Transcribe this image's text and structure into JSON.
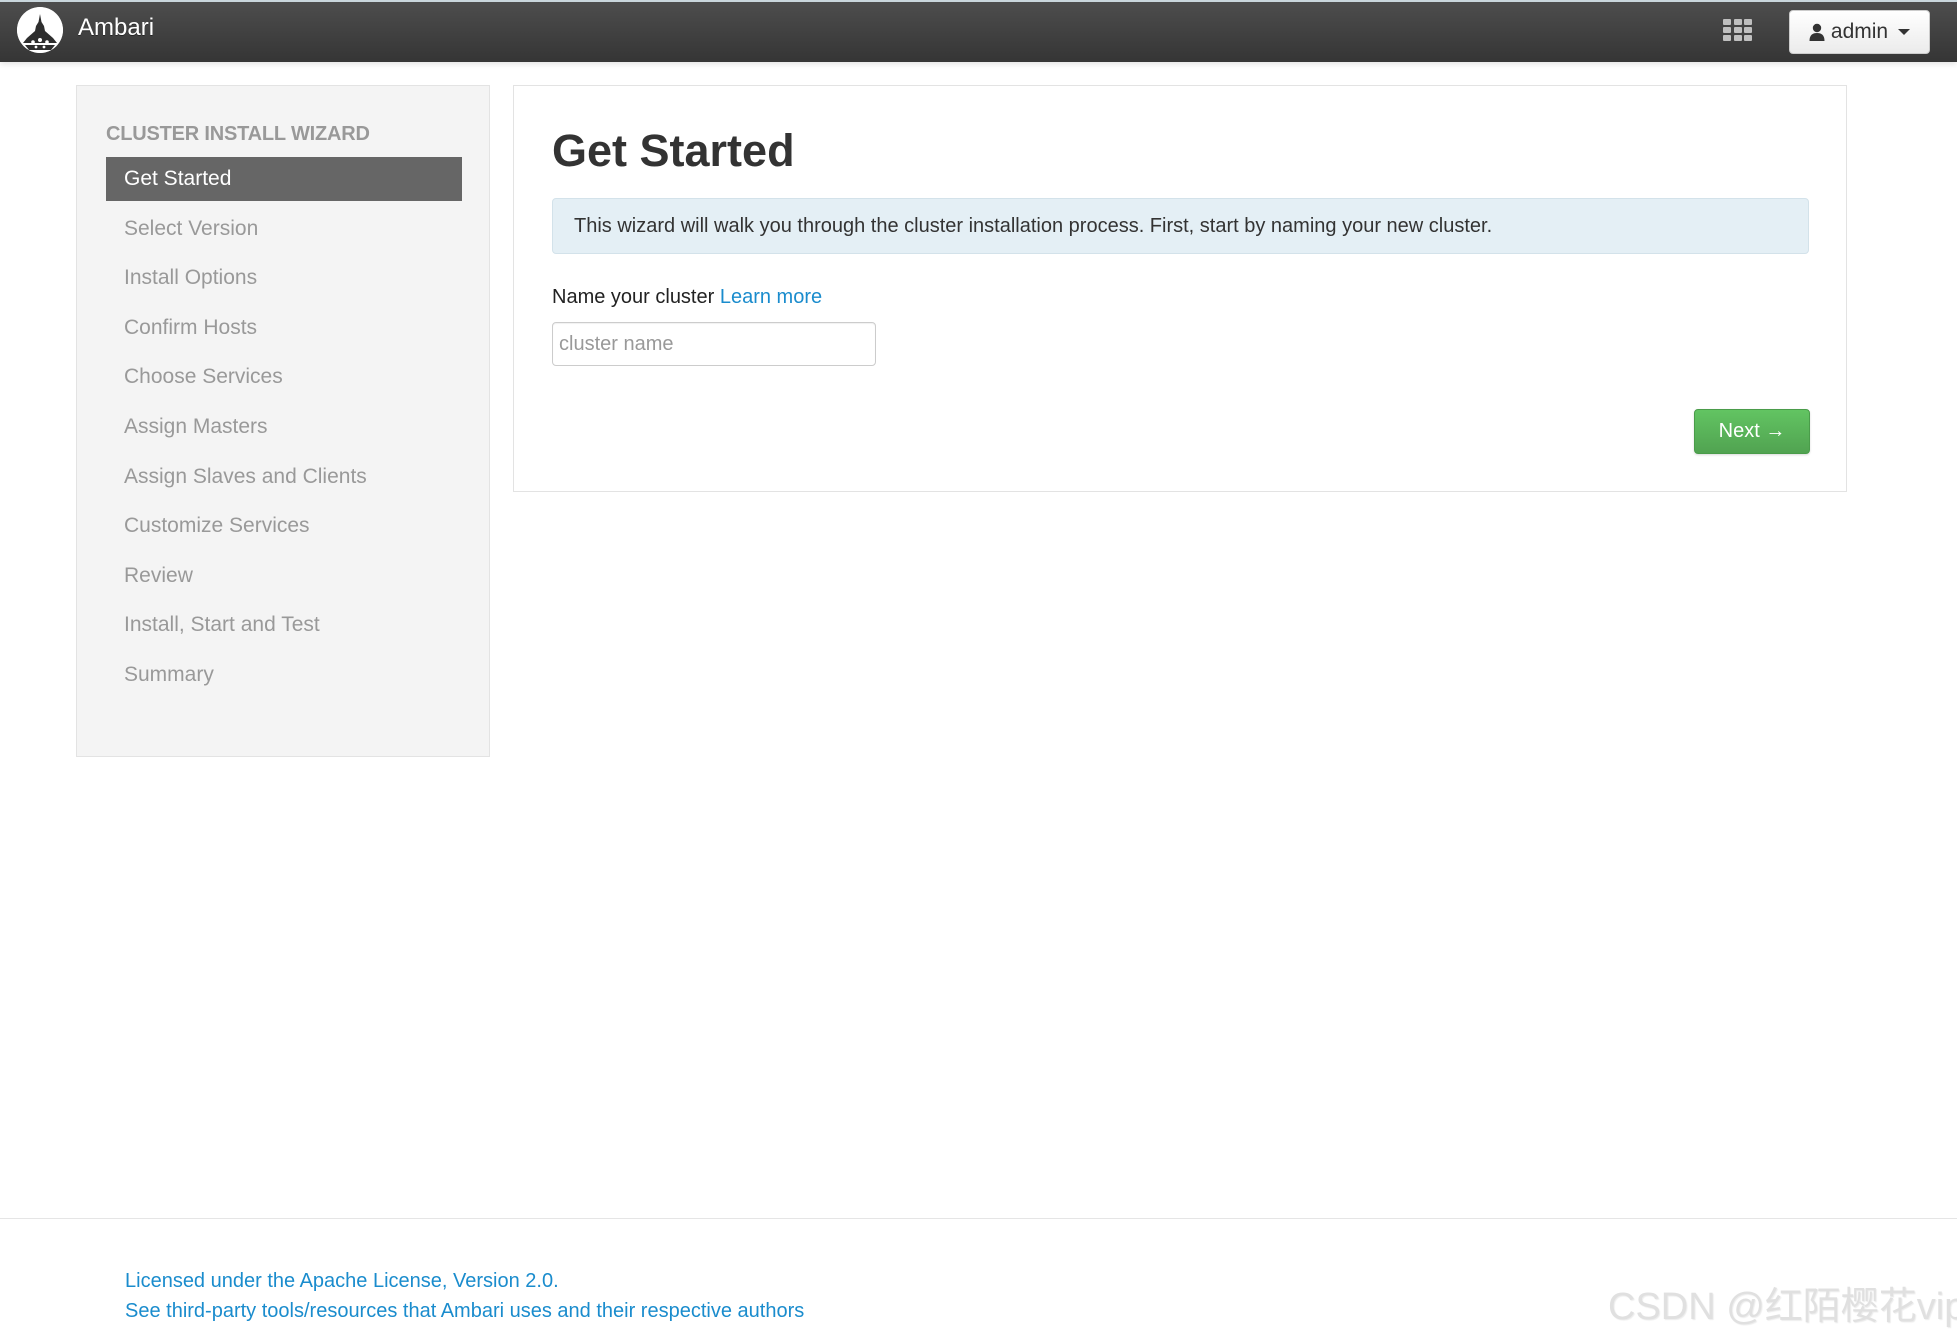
{
  "navbar": {
    "brand": "Ambari",
    "logo_icon": "ambari-logo",
    "apps_icon": "grid-icon",
    "user_menu": {
      "icon": "user-icon",
      "label": "admin",
      "caret_icon": "caret-down-icon"
    }
  },
  "sidebar": {
    "heading": "CLUSTER INSTALL WIZARD",
    "steps": [
      {
        "label": "Get Started",
        "active": true
      },
      {
        "label": "Select Version",
        "active": false
      },
      {
        "label": "Install Options",
        "active": false
      },
      {
        "label": "Confirm Hosts",
        "active": false
      },
      {
        "label": "Choose Services",
        "active": false
      },
      {
        "label": "Assign Masters",
        "active": false
      },
      {
        "label": "Assign Slaves and Clients",
        "active": false
      },
      {
        "label": "Customize Services",
        "active": false
      },
      {
        "label": "Review",
        "active": false
      },
      {
        "label": "Install, Start and Test",
        "active": false
      },
      {
        "label": "Summary",
        "active": false
      }
    ]
  },
  "main": {
    "title": "Get Started",
    "alert": "This wizard will walk you through the cluster installation process. First, start by naming your new cluster.",
    "field_label": "Name your cluster",
    "learn_more": "Learn more",
    "cluster_name": {
      "value": "",
      "placeholder": "cluster name"
    },
    "next_button": "Next →"
  },
  "footer": {
    "license": "Licensed under the Apache License, Version 2.0.",
    "third_party": "See third-party tools/resources that Ambari uses and their respective authors"
  },
  "watermark": "CSDN @红陌樱花vip",
  "colors": {
    "navbar": "#3f3f3f",
    "active_step": "#666666",
    "alert_bg": "#e4eff5",
    "link": "#1a8ccd",
    "next_button": "#5cb85c"
  }
}
